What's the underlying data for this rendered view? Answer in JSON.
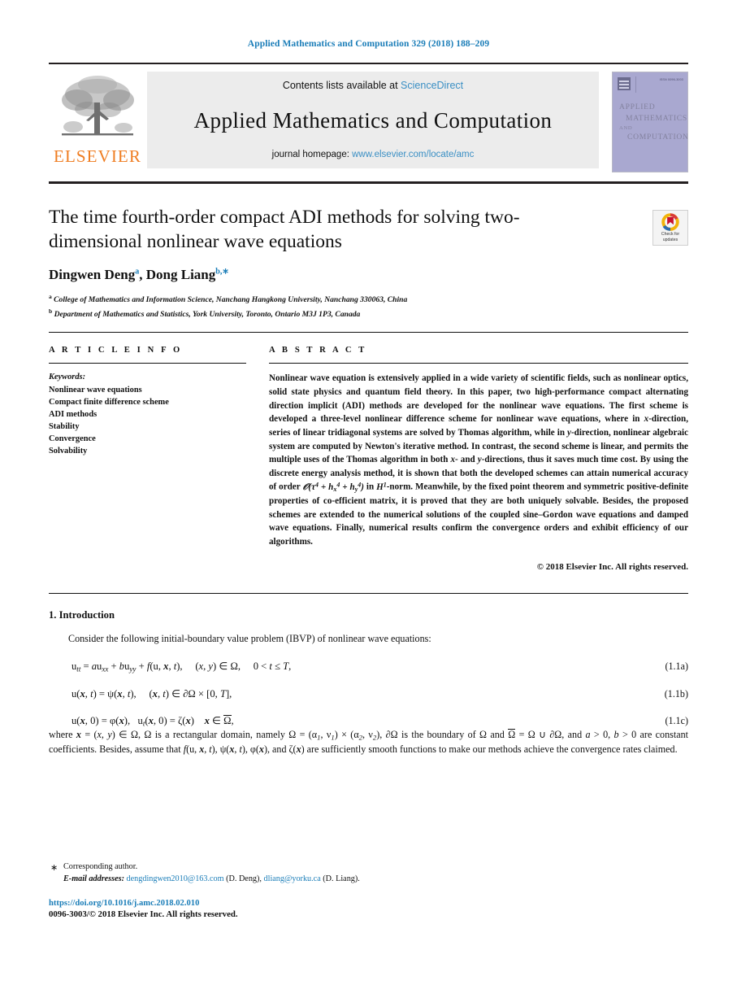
{
  "running_head": "Applied Mathematics and Computation 329 (2018) 188–209",
  "masthead": {
    "publisher_wordmark": "ELSEVIER",
    "contents_prefix": "Contents lists available at ",
    "contents_link": "ScienceDirect",
    "journal_name": "Applied Mathematics and Computation",
    "homepage_prefix": "journal homepage: ",
    "homepage_link": "www.elsevier.com/locate/amc",
    "cover": {
      "issue_code": "ISSN 0096-3003",
      "line1": "APPLIED",
      "line2": "MATHEMATICS",
      "line3": "AND",
      "line4": "COMPUTATION"
    }
  },
  "article": {
    "title": "The time fourth-order compact ADI methods for solving two-dimensional nonlinear wave equations",
    "authors_html": "Dingwen Deng, Dong Liang",
    "author1": "Dingwen Deng",
    "author1_marker": "a",
    "author2": "Dong Liang",
    "author2_marker": "b,",
    "author2_corr": "∗",
    "affiliation_a_marker": "a",
    "affiliation_a": "College of Mathematics and Information Science, Nanchang Hangkong University, Nanchang 330063, China",
    "affiliation_b_marker": "b",
    "affiliation_b": "Department of Mathematics and Statistics, York University, Toronto, Ontario M3J 1P3, Canada",
    "crossmark_label_line1": "Check for",
    "crossmark_label_line2": "updates"
  },
  "article_info": {
    "heading": "A R T I C L E    I N F O",
    "keywords_label": "Keywords:",
    "keywords": [
      "Nonlinear wave equations",
      "Compact finite difference scheme",
      "ADI methods",
      "Stability",
      "Convergence",
      "Solvability"
    ]
  },
  "abstract": {
    "heading": "A B S T R A C T",
    "paragraph_part1": "Nonlinear wave equation is extensively applied in a wide variety of scientific fields, such as nonlinear optics, solid state physics and quantum field theory. In this paper, two high-performance compact alternating direction implicit (ADI) methods are developed for the nonlinear wave equations. The first scheme is developed a three-level nonlinear difference scheme for nonlinear wave equations, where in ",
    "x_italic": "x",
    "paragraph_part2": "-direction, series of linear tridiagonal systems are solved by Thomas algorithm, while in ",
    "y_italic": "y",
    "paragraph_part3": "-direction, nonlinear algebraic system are computed by Newton's iterative method. In contrast, the second scheme is linear, and permits the multiple uses of the Thomas algorithm in both ",
    "x_italic2": "x",
    "paragraph_part4": "- and ",
    "y_italic2": "y",
    "paragraph_part5": "-directions, thus it saves much time cost. By using the discrete energy analysis method, it is shown that both the developed schemes can attain numerical accuracy of order ",
    "order_expr": "O(τ⁴ + hx⁴ + hy⁴)",
    "paragraph_part6": " in ",
    "norm_expr": "H¹",
    "paragraph_part7": "-norm. Meanwhile, by the fixed point theorem and symmetric positive-definite properties of co-efficient matrix, it is proved that they are both uniquely solvable. Besides, the proposed schemes are extended to the numerical solutions of the coupled sine–Gordon wave equations and damped wave equations. Finally, numerical results confirm the convergence orders and exhibit efficiency of our algorithms.",
    "copyright": "© 2018 Elsevier Inc. All rights reserved."
  },
  "introduction": {
    "section_number_title": "1. Introduction",
    "lead_paragraph": "Consider the following initial-boundary value problem (IBVP) of nonlinear wave equations:",
    "equations": [
      {
        "number": "(1.1a)"
      },
      {
        "number": "(1.1b)"
      },
      {
        "number": "(1.1c)"
      }
    ],
    "where_paragraph_note": "where x = (x, y) ∈ Ω, Ω is a rectangular domain, namely Ω = (α1, ν1) × (α2, ν2), ∂Ω is the boundary of Ω and Ω̄ = Ω ∪ ∂Ω, and a > 0, b > 0 are constant coefficients. Besides, assume that f(u, x, t), ψ(x, t), φ(x), and ζ(x) are sufficiently smooth functions to make our methods achieve the convergence rates claimed."
  },
  "footnotes": {
    "corresponding_marker": "∗",
    "corresponding_author": "Corresponding author.",
    "email_label": "E-mail addresses:",
    "email1": "dengdingwen2010@163.com",
    "email1_owner": "(D. Deng),",
    "email2": "dliang@yorku.ca",
    "email2_owner": "(D. Liang).",
    "doi": "https://doi.org/10.1016/j.amc.2018.02.010",
    "issn_copyright": "0096-3003/© 2018 Elsevier Inc. All rights reserved."
  },
  "colors": {
    "link_blue": "#1a7db8",
    "sd_blue": "#3a8fc4",
    "elsevier_orange": "#ef7d22",
    "cover_lavender": "#a9a8d0",
    "masthead_gray": "#ececec"
  }
}
